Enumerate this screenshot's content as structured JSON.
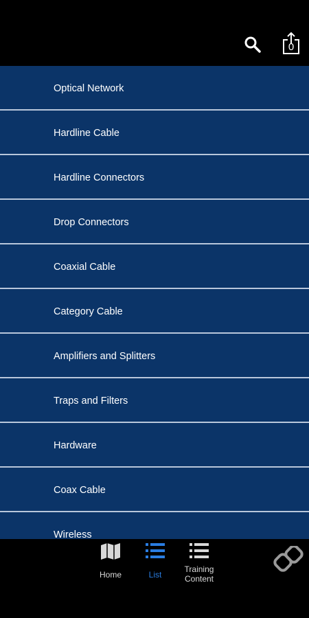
{
  "header": {
    "search_icon": "search-icon",
    "share_icon": "share-icon",
    "share_count": "0"
  },
  "list": {
    "items": [
      {
        "label": "Optical Network"
      },
      {
        "label": "Hardline Cable"
      },
      {
        "label": "Hardline Connectors"
      },
      {
        "label": "Drop Connectors"
      },
      {
        "label": "Coaxial Cable"
      },
      {
        "label": "Category Cable"
      },
      {
        "label": "Amplifiers and Splitters"
      },
      {
        "label": "Traps and Filters"
      },
      {
        "label": "Hardware"
      },
      {
        "label": "Coax Cable"
      },
      {
        "label": "Wireless"
      }
    ]
  },
  "bottom_nav": {
    "home_label": "Home",
    "list_label": "List",
    "training_label_line1": "Training",
    "training_label_line2": "Content",
    "home_icon": "map-icon",
    "list_icon": "list-icon",
    "training_icon": "list-icon",
    "logo_icon": "chain-link-logo"
  },
  "colors": {
    "list_background": "#0b3468",
    "divider": "#b9c7db",
    "active_tab": "#2a7de1",
    "bar_background": "#000000"
  }
}
